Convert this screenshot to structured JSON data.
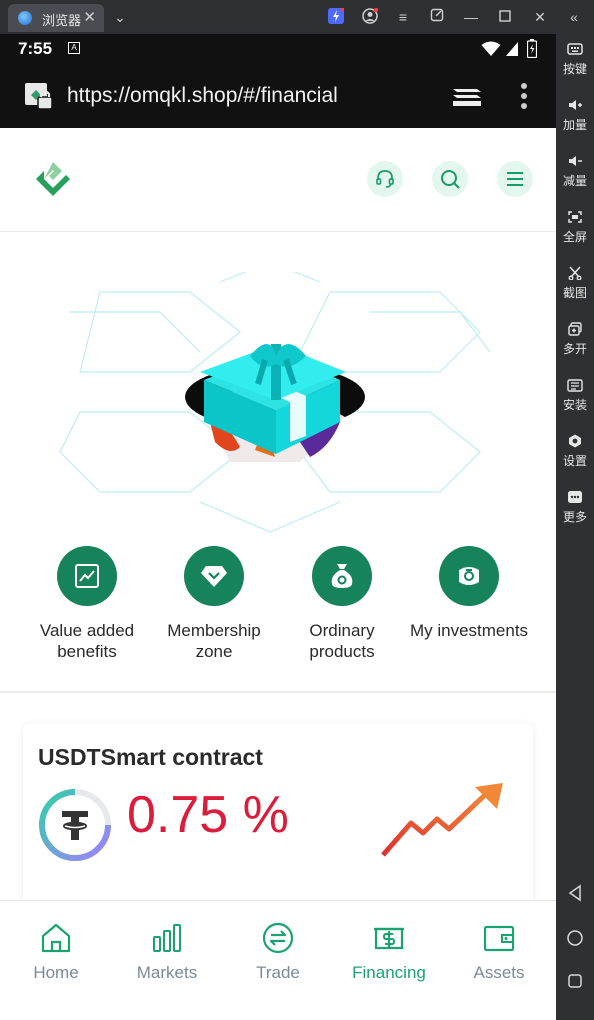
{
  "emulator": {
    "tab_title": "浏览器",
    "tab_close": "✕",
    "sidebar": [
      {
        "label": "按键",
        "icon": "keyboard-icon"
      },
      {
        "label": "加量",
        "icon": "volume-up-icon"
      },
      {
        "label": "减量",
        "icon": "volume-down-icon"
      },
      {
        "label": "全屏",
        "icon": "fullscreen-icon"
      },
      {
        "label": "截图",
        "icon": "scissors-icon"
      },
      {
        "label": "多开",
        "icon": "multi-instance-icon"
      },
      {
        "label": "安装",
        "icon": "apk-install-icon"
      },
      {
        "label": "设置",
        "icon": "settings-icon"
      },
      {
        "label": "更多",
        "icon": "more-icon"
      }
    ]
  },
  "status_bar": {
    "time": "7:55",
    "notification_icon": "A"
  },
  "browser": {
    "url": "https://omqkl.shop/#/financial"
  },
  "shortcuts": [
    {
      "label": "Value added benefits",
      "icon": "trend-chart-icon"
    },
    {
      "label": "Membership zone",
      "icon": "diamond-icon"
    },
    {
      "label": "Ordinary products",
      "icon": "money-bag-icon"
    },
    {
      "label": "My investments",
      "icon": "wallet-coin-icon"
    }
  ],
  "contract_card": {
    "title": "USDTSmart contract",
    "rate": "0.75 %",
    "coin_icon": "tether-icon"
  },
  "bottom_nav": [
    {
      "label": "Home",
      "icon": "home-icon",
      "active": false
    },
    {
      "label": "Markets",
      "icon": "bar-chart-icon",
      "active": false
    },
    {
      "label": "Trade",
      "icon": "exchange-icon",
      "active": false
    },
    {
      "label": "Financing",
      "icon": "financing-icon",
      "active": true
    },
    {
      "label": "Assets",
      "icon": "wallet-icon",
      "active": false
    }
  ],
  "colors": {
    "brand_green": "#17835a",
    "active_nav": "#1aa36f",
    "rate_red": "#d91d3a",
    "inactive_nav": "#7a8a9a"
  }
}
